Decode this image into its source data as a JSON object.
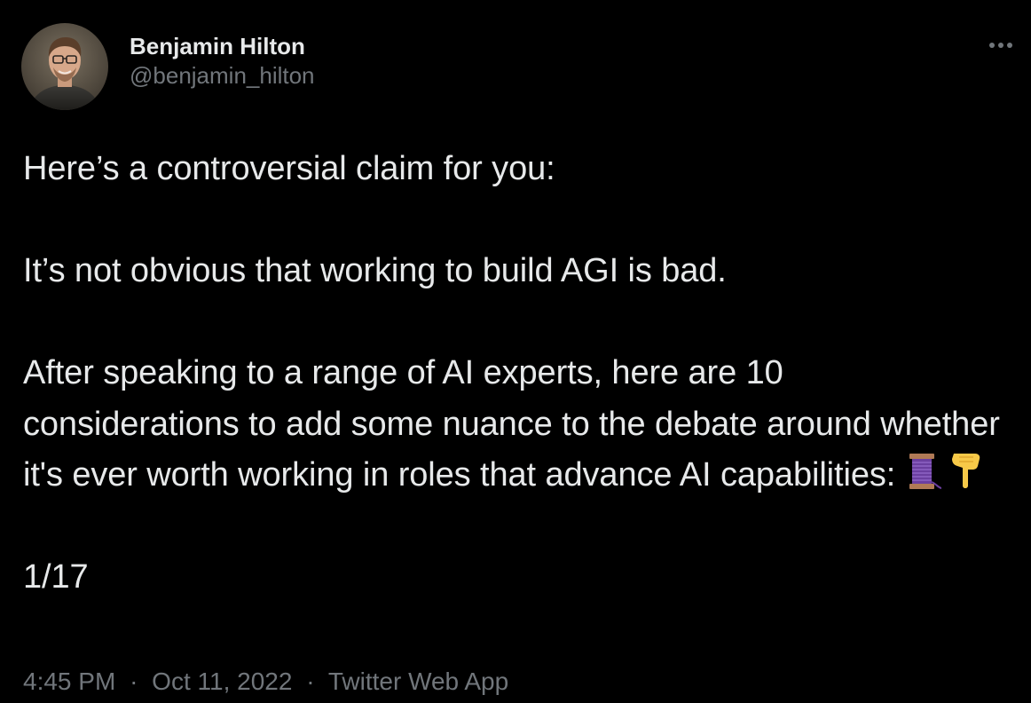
{
  "author": {
    "display_name": "Benjamin Hilton",
    "handle": "@benjamin_hilton"
  },
  "tweet": {
    "paragraphs": [
      "Here’s a controversial claim for you:",
      "It’s not obvious that working to build AGI is bad.",
      "After speaking to a range of AI experts, here are 10 considerations to add some nuance to the debate around whether it's ever worth working in roles that advance AI capabilities:",
      "1/17"
    ],
    "emojis": [
      "thread-spool-emoji",
      "pointing-down-emoji"
    ]
  },
  "meta": {
    "time": "4:45 PM",
    "separator": "·",
    "date": "Oct 11, 2022",
    "source": "Twitter Web App"
  },
  "colors": {
    "background": "#000000",
    "primary_text": "#e7e9ea",
    "secondary_text": "#71767b"
  },
  "icons": {
    "more": "more-dots-icon"
  }
}
